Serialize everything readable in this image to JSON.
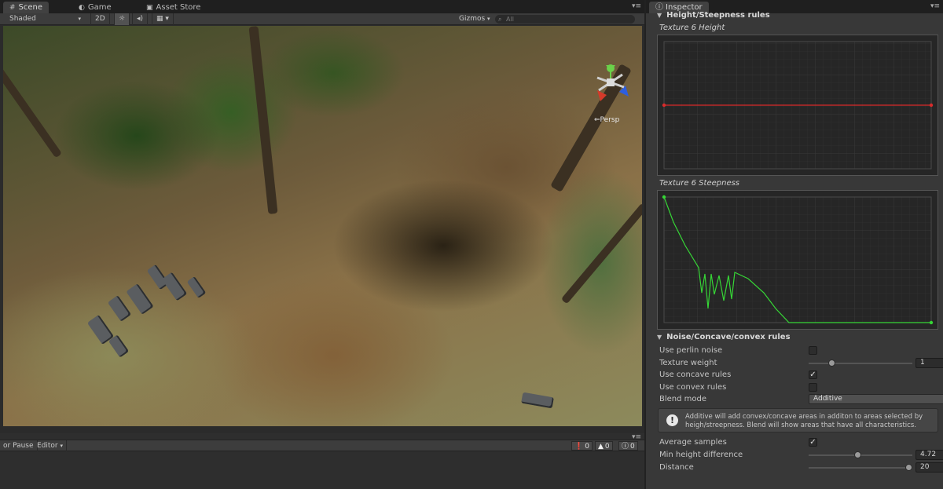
{
  "scene": {
    "tabs": [
      {
        "label": "Scene",
        "icon": "grid-icon"
      },
      {
        "label": "Game",
        "icon": "pacman-icon"
      },
      {
        "label": "Asset Store",
        "icon": "bag-icon"
      }
    ],
    "toolbar": {
      "shading_mode": "Shaded",
      "mode_2d": "2D",
      "gizmos_label": "Gizmos",
      "search_placeholder": "All"
    },
    "view_label": "Persp"
  },
  "console": {
    "error_pause": "or Pause",
    "editor_label": "Editor",
    "counts": {
      "info": "0",
      "warnings": "0",
      "errors": "0"
    }
  },
  "inspector": {
    "tab_label": "Inspector",
    "height_section": {
      "title": "Height/Steepness rules",
      "height_curve_label": "Texture 6 Height",
      "steepness_curve_label": "Texture 6 Steepness"
    },
    "noise_section": {
      "title": "Noise/Concave/convex rules",
      "use_perlin_noise": {
        "label": "Use perlin noise",
        "checked": false
      },
      "texture_weight": {
        "label": "Texture weight",
        "value": "1",
        "fraction": 0.2
      },
      "use_concave_rules": {
        "label": "Use concave rules",
        "checked": true
      },
      "use_convex_rules": {
        "label": "Use convex rules",
        "checked": false
      },
      "blend_mode": {
        "label": "Blend mode",
        "value": "Additive"
      },
      "help_text": "Additive will add convex/concave areas in additon to areas selected by heigh/streepness. Blend will show areas that have all characteristics.",
      "average_samples": {
        "label": "Average samples",
        "checked": true
      },
      "min_height_difference": {
        "label": "Min height difference",
        "value": "4.72",
        "fraction": 0.47
      },
      "distance": {
        "label": "Distance",
        "value": "20",
        "fraction": 1.0
      }
    },
    "colors": {
      "height_curve": "#d92b2b",
      "steepness_curve": "#36d636",
      "panel_background": "#383838"
    }
  }
}
